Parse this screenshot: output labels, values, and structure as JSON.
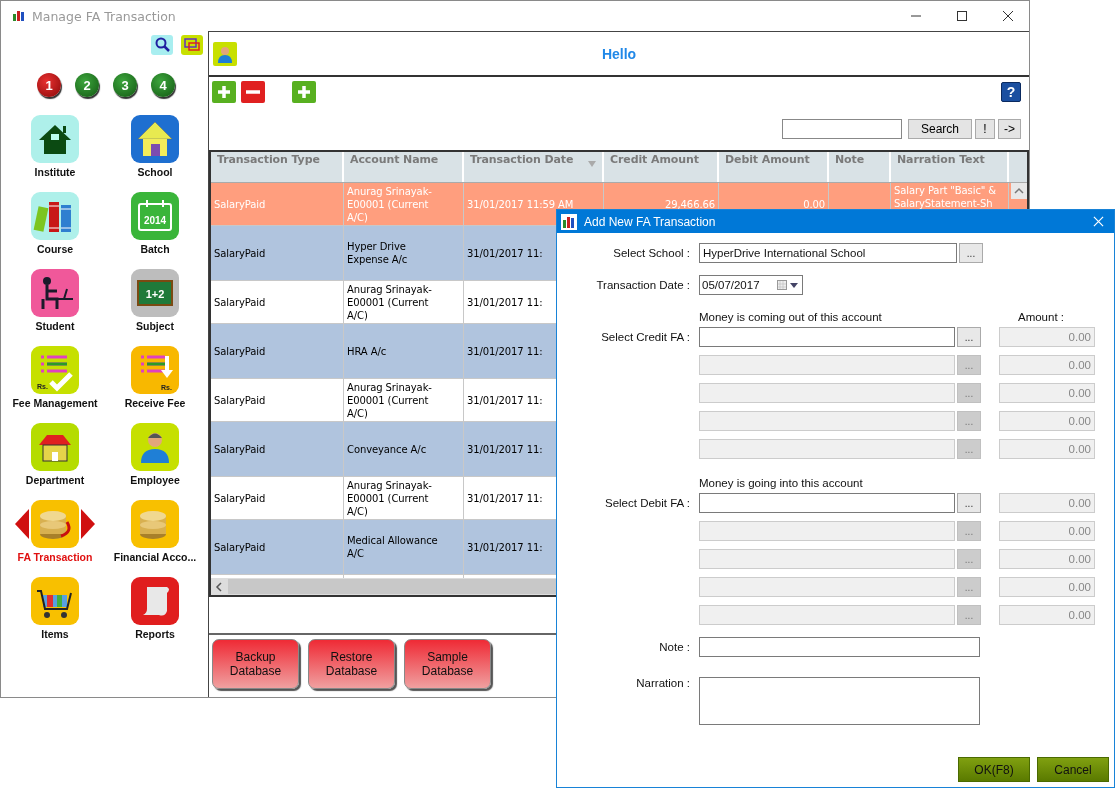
{
  "window": {
    "title": "Manage FA Transaction"
  },
  "sidebar": {
    "pages": [
      {
        "label": "1",
        "selected": true
      },
      {
        "label": "2",
        "selected": false
      },
      {
        "label": "3",
        "selected": false
      },
      {
        "label": "4",
        "selected": false
      }
    ],
    "items": [
      {
        "label": "Institute",
        "kind": "institute",
        "selected": false
      },
      {
        "label": "School",
        "kind": "school",
        "selected": false
      },
      {
        "label": "Course",
        "kind": "course",
        "selected": false
      },
      {
        "label": "Batch",
        "kind": "batch",
        "selected": false
      },
      {
        "label": "Student",
        "kind": "student",
        "selected": false
      },
      {
        "label": "Subject",
        "kind": "subject",
        "selected": false
      },
      {
        "label": "Fee Management",
        "kind": "fee",
        "selected": false
      },
      {
        "label": "Receive Fee",
        "kind": "receive",
        "selected": false
      },
      {
        "label": "Department",
        "kind": "department",
        "selected": false
      },
      {
        "label": "Employee",
        "kind": "employee",
        "selected": false
      },
      {
        "label": "FA Transaction",
        "kind": "fa",
        "selected": true
      },
      {
        "label": "Financial Acco...",
        "kind": "financial",
        "selected": false
      },
      {
        "label": "Items",
        "kind": "items",
        "selected": false
      },
      {
        "label": "Reports",
        "kind": "reports",
        "selected": false
      }
    ],
    "icon_texts": [
      "2014",
      "1+2",
      "Rs.",
      "Rs."
    ]
  },
  "header": {
    "greeting": "Hello"
  },
  "toolbar": {
    "buttons": [
      {
        "kind": "add"
      },
      {
        "kind": "remove"
      },
      {
        "kind": "add"
      }
    ],
    "help": "?"
  },
  "search": {
    "button": "Search",
    "extra_buttons": [
      "!",
      "->"
    ]
  },
  "table": {
    "columns": [
      {
        "label": "Transaction Type",
        "sorted": false
      },
      {
        "label": "Account Name",
        "sorted": false
      },
      {
        "label": "Transaction Date",
        "sorted": true
      },
      {
        "label": "Credit Amount",
        "sorted": false
      },
      {
        "label": "Debit Amount",
        "sorted": false
      },
      {
        "label": "Note",
        "sorted": false
      },
      {
        "label": "Narration Text",
        "sorted": false
      }
    ],
    "rows": [
      {
        "selected": true,
        "cells": [
          "SalaryPaid",
          "Anurag Srinayak-E00001 (Current A/C)",
          "31/01/2017 11:59 AM",
          "29,466.66",
          "0.00",
          "",
          "Salary Part \"Basic\" & SalaryStatement-Sh"
        ]
      },
      {
        "selected": false,
        "cells": [
          "SalaryPaid",
          "Hyper Drive Expense A/c",
          "31/01/2017 11:"
        ]
      },
      {
        "selected": false,
        "cells": [
          "SalaryPaid",
          "Anurag Srinayak-E00001 (Current A/C)",
          "31/01/2017 11:"
        ]
      },
      {
        "selected": false,
        "cells": [
          "SalaryPaid",
          "HRA A/c",
          "31/01/2017 11:"
        ]
      },
      {
        "selected": false,
        "cells": [
          "SalaryPaid",
          "Anurag Srinayak-E00001 (Current A/C)",
          "31/01/2017 11:"
        ]
      },
      {
        "selected": false,
        "cells": [
          "SalaryPaid",
          "Conveyance A/c",
          "31/01/2017 11:"
        ]
      },
      {
        "selected": false,
        "cells": [
          "SalaryPaid",
          "Anurag Srinayak-E00001 (Current A/C)",
          "31/01/2017 11:"
        ]
      },
      {
        "selected": false,
        "cells": [
          "SalaryPaid",
          "Medical Allowance A/C",
          "31/01/2017 11:"
        ]
      }
    ]
  },
  "database_buttons": [
    "Backup Database",
    "Restore Database",
    "Sample Database"
  ],
  "dialog": {
    "title": "Add New FA Transaction",
    "school": {
      "label": "Select School :",
      "value": "HyperDrive International School",
      "browse": "..."
    },
    "date": {
      "label": "Transaction Date :",
      "value": "05/07/2017"
    },
    "amount_label": "Amount :",
    "credit": {
      "caption": "Money is coming out of this account",
      "label": "Select Credit FA :",
      "rows": [
        {
          "disabled": false,
          "browse": "...",
          "amount": "0.00"
        },
        {
          "disabled": true,
          "browse": "...",
          "amount": "0.00"
        },
        {
          "disabled": true,
          "browse": "...",
          "amount": "0.00"
        },
        {
          "disabled": true,
          "browse": "...",
          "amount": "0.00"
        },
        {
          "disabled": true,
          "browse": "...",
          "amount": "0.00"
        }
      ]
    },
    "debit": {
      "caption": "Money is going into this account",
      "label": "Select Debit FA :",
      "rows": [
        {
          "disabled": false,
          "browse": "...",
          "amount": "0.00"
        },
        {
          "disabled": true,
          "browse": "...",
          "amount": "0.00"
        },
        {
          "disabled": true,
          "browse": "...",
          "amount": "0.00"
        },
        {
          "disabled": true,
          "browse": "...",
          "amount": "0.00"
        },
        {
          "disabled": true,
          "browse": "...",
          "amount": "0.00"
        }
      ]
    },
    "note": {
      "label": "Note :"
    },
    "narration": {
      "label": "Narration :"
    },
    "buttons": [
      "OK(F8)",
      "Cancel"
    ]
  }
}
